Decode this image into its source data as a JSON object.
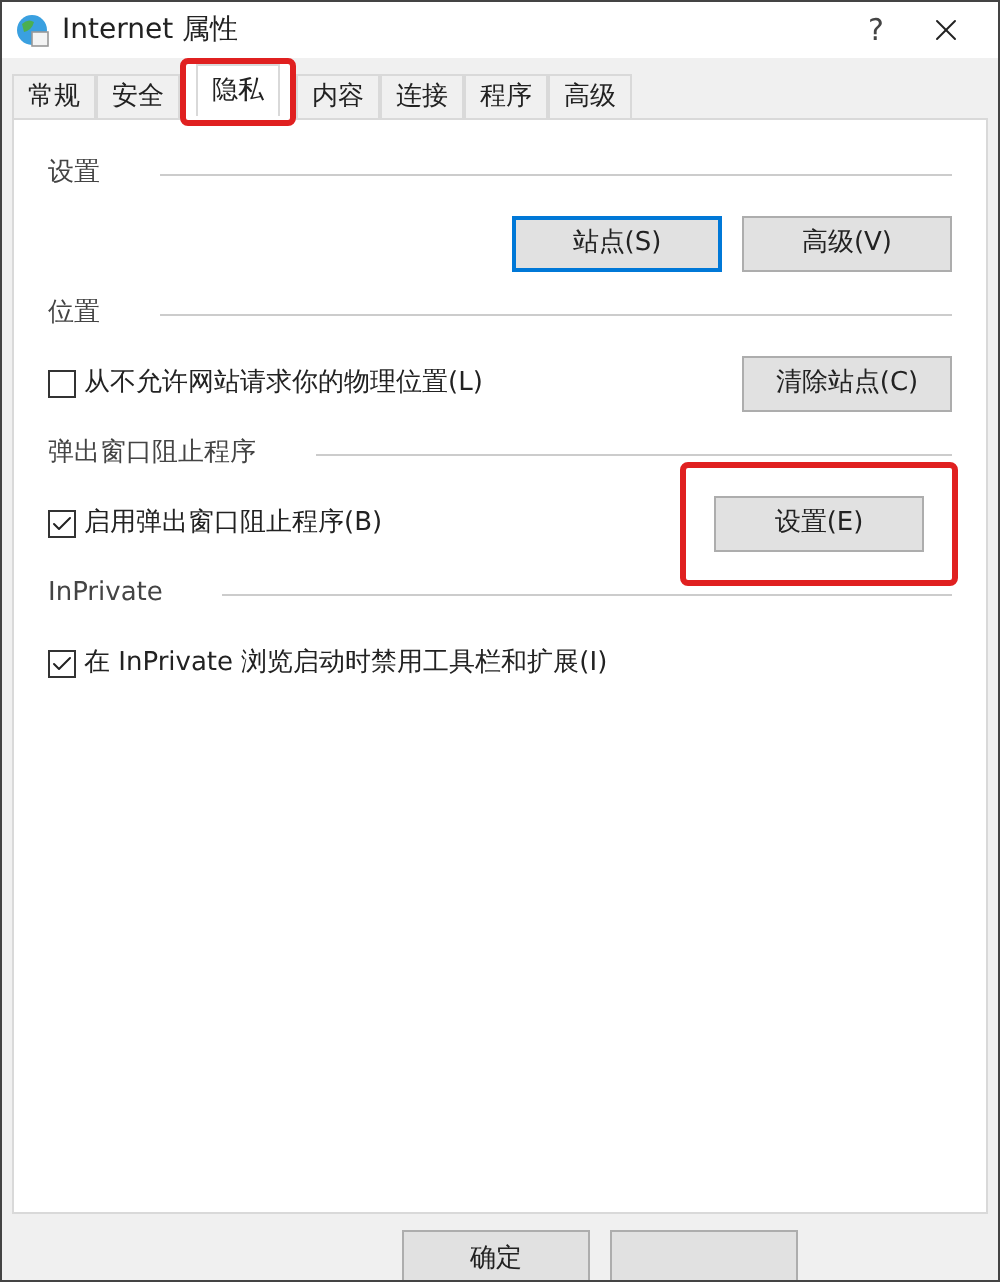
{
  "window": {
    "title": "Internet 属性",
    "help": "?"
  },
  "tabs": [
    {
      "label": "常规",
      "selected": false,
      "annotated": false
    },
    {
      "label": "安全",
      "selected": false,
      "annotated": false
    },
    {
      "label": "隐私",
      "selected": true,
      "annotated": true
    },
    {
      "label": "内容",
      "selected": false,
      "annotated": false
    },
    {
      "label": "连接",
      "selected": false,
      "annotated": false
    },
    {
      "label": "程序",
      "selected": false,
      "annotated": false
    },
    {
      "label": "高级",
      "selected": false,
      "annotated": false
    }
  ],
  "sections": [
    {
      "title": "设置",
      "rows": [
        {
          "buttons": [
            {
              "label": "站点(S)",
              "focused": true,
              "annotated": false
            },
            {
              "label": "高级(V)",
              "focused": false,
              "annotated": false
            }
          ]
        }
      ]
    },
    {
      "title": "位置",
      "rows": [
        {
          "checkbox": {
            "label": "从不允许网站请求你的物理位置(L)",
            "checked": false
          },
          "buttons": [
            {
              "label": "清除站点(C)",
              "focused": false,
              "annotated": false
            }
          ]
        }
      ]
    },
    {
      "title": "弹出窗口阻止程序",
      "rows": [
        {
          "checkbox": {
            "label": "启用弹出窗口阻止程序(B)",
            "checked": true
          },
          "buttons": [
            {
              "label": "设置(E)",
              "focused": false,
              "annotated": true
            }
          ]
        }
      ]
    },
    {
      "title": "InPrivate",
      "rows": [
        {
          "checkbox": {
            "label": "在 InPrivate 浏览启动时禁用工具栏和扩展(I)",
            "checked": true
          }
        }
      ]
    }
  ],
  "footer_buttons": [
    {
      "kind": "labeled",
      "label": "确定"
    },
    {
      "kind": "blank"
    }
  ]
}
